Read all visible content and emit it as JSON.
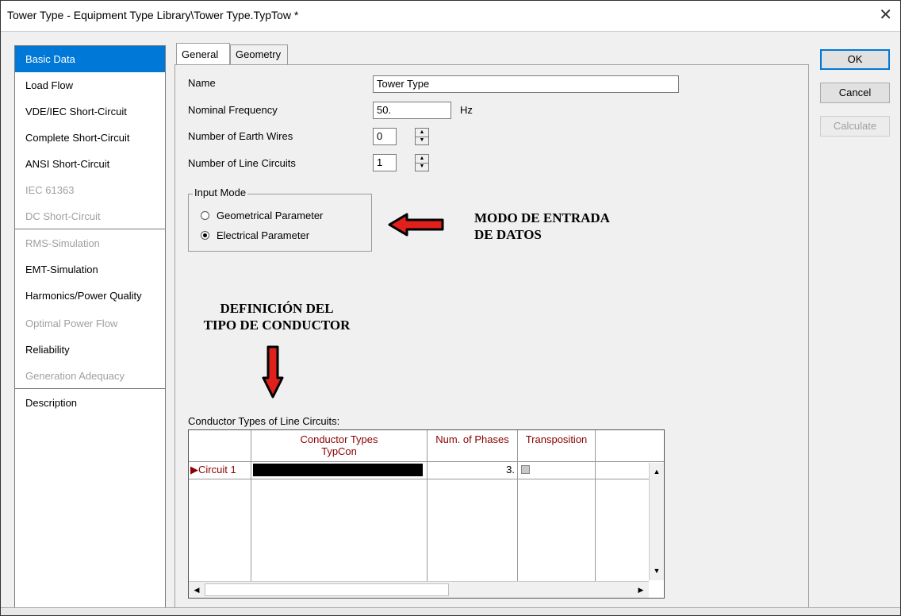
{
  "window": {
    "title": "Tower Type - Equipment Type Library\\Tower Type.TypTow *",
    "close_glyph": "✕"
  },
  "sidebar": {
    "items": [
      {
        "label": "Basic Data",
        "state": "selected"
      },
      {
        "label": "Load Flow",
        "state": "enabled"
      },
      {
        "label": "VDE/IEC Short-Circuit",
        "state": "enabled"
      },
      {
        "label": "Complete Short-Circuit",
        "state": "enabled"
      },
      {
        "label": "ANSI Short-Circuit",
        "state": "enabled"
      },
      {
        "label": "IEC 61363",
        "state": "disabled"
      },
      {
        "label": "DC Short-Circuit",
        "state": "disabled"
      },
      {
        "label": "RMS-Simulation",
        "state": "disabled"
      },
      {
        "label": "EMT-Simulation",
        "state": "enabled"
      },
      {
        "label": "Harmonics/Power Quality",
        "state": "enabled"
      },
      {
        "label": "Optimal Power Flow",
        "state": "disabled"
      },
      {
        "label": "Reliability",
        "state": "enabled"
      },
      {
        "label": "Generation Adequacy",
        "state": "disabled"
      },
      {
        "label": "Description",
        "state": "enabled"
      }
    ]
  },
  "tabs": [
    {
      "label": "General",
      "active": true
    },
    {
      "label": "Geometry",
      "active": false
    }
  ],
  "form": {
    "name_label": "Name",
    "name_value": "Tower Type",
    "freq_label": "Nominal Frequency",
    "freq_value": "50.",
    "freq_unit": "Hz",
    "earth_label": "Number of Earth Wires",
    "earth_value": "0",
    "circuits_label": "Number of Line Circuits",
    "circuits_value": "1"
  },
  "input_mode": {
    "legend": "Input Mode",
    "options": [
      {
        "label": "Geometrical Parameter",
        "checked": false
      },
      {
        "label": "Electrical Parameter",
        "checked": true
      }
    ]
  },
  "annotations": {
    "mode_line1": "MODO DE ENTRADA",
    "mode_line2": "DE DATOS",
    "conductor_line1": "DEFINICIÓN DEL",
    "conductor_line2": "TIPO DE CONDUCTOR",
    "arrow_color": "#e0201b"
  },
  "buttons": {
    "ok": "OK",
    "cancel": "Cancel",
    "calculate": "Calculate"
  },
  "conductor_table": {
    "caption": "Conductor Types of Line Circuits:",
    "headers": {
      "conductor_types": "Conductor Types",
      "conductor_types_sub": "TypCon",
      "num_phases": "Num. of Phases",
      "transposition": "Transposition"
    },
    "rows": [
      {
        "label": "Circuit 1",
        "conductor_type": "",
        "num_phases": "3.",
        "transposition": false
      }
    ]
  },
  "colors": {
    "accent": "#0078d7",
    "header_text": "#8b0000",
    "disabled_text": "#a0a0a0"
  }
}
